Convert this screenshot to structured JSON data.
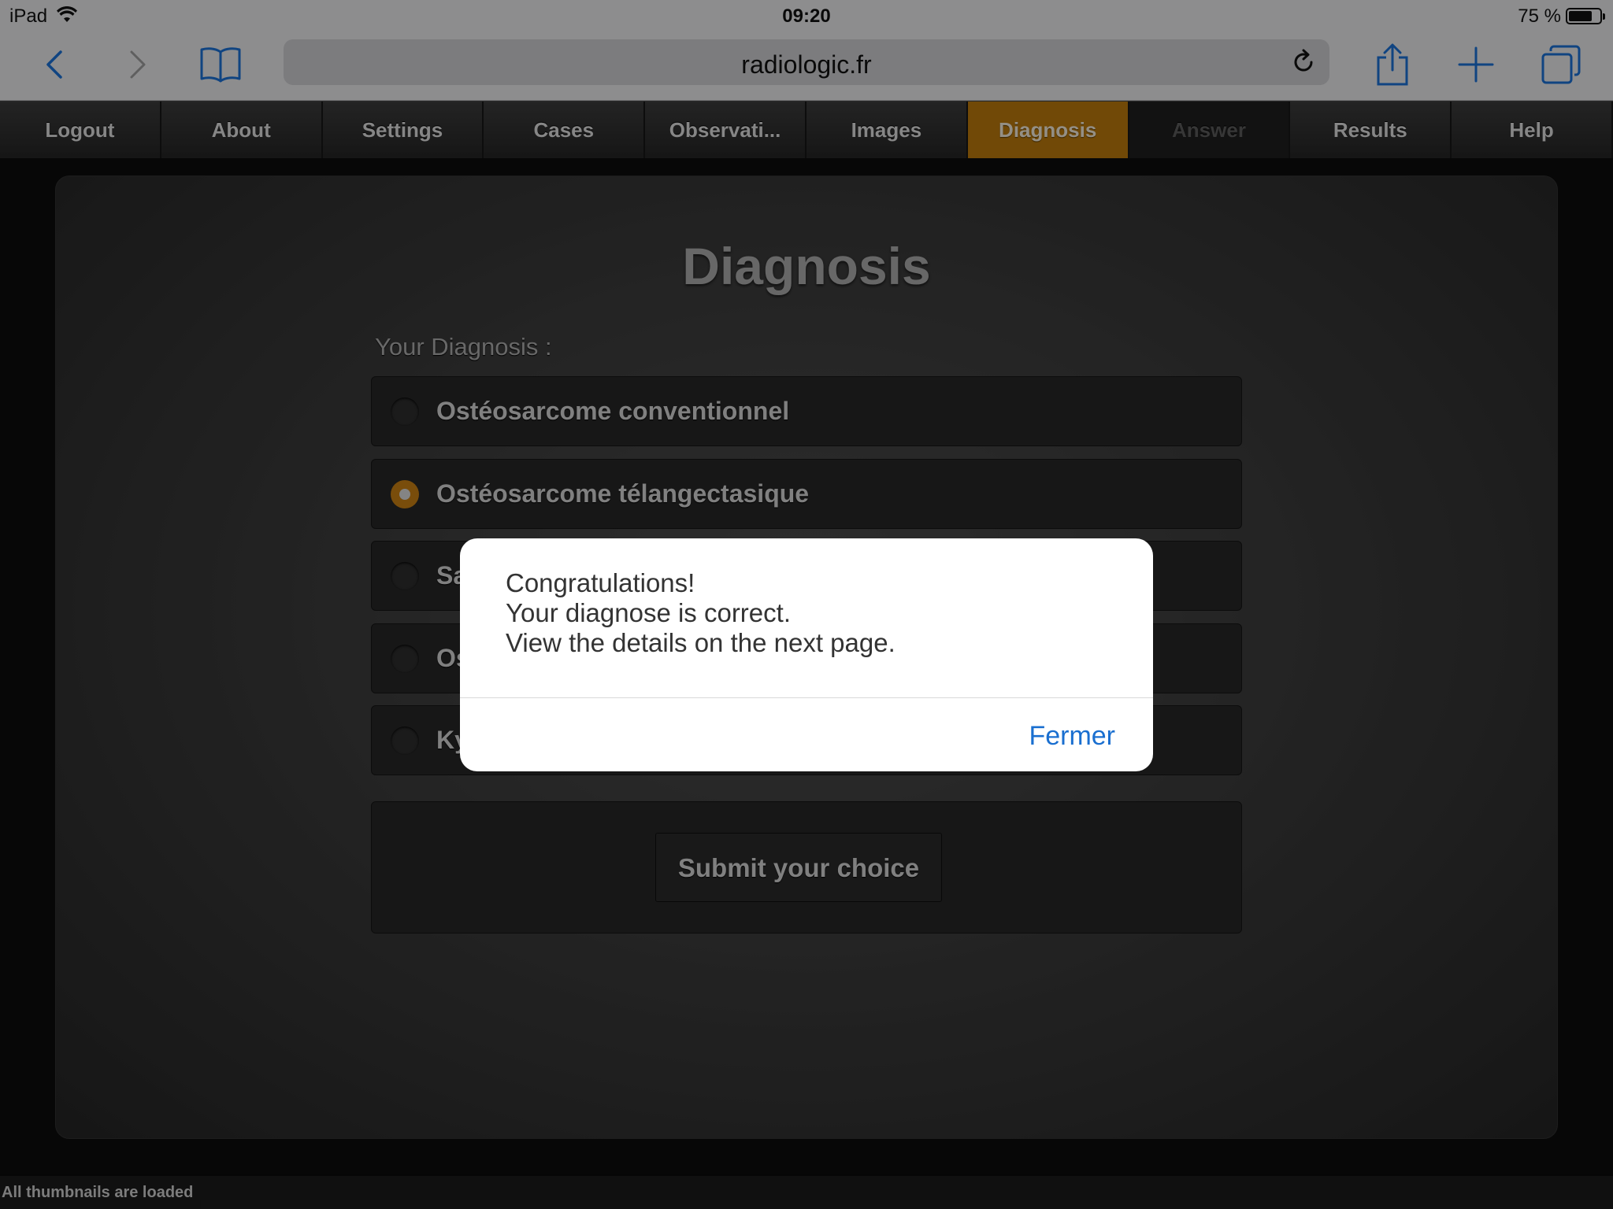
{
  "status_bar": {
    "device": "iPad",
    "time": "09:20",
    "battery": "75 %",
    "battery_level": 0.75,
    "wifi_icon": "wifi-icon"
  },
  "browser": {
    "url": "radiologic.fr",
    "icons": [
      "back-icon",
      "forward-icon",
      "bookmarks-icon",
      "reload-icon",
      "share-icon",
      "new-tab-icon",
      "tabs-icon"
    ]
  },
  "nav": {
    "tabs": [
      {
        "label": "Logout",
        "state": "normal"
      },
      {
        "label": "About",
        "state": "normal"
      },
      {
        "label": "Settings",
        "state": "normal"
      },
      {
        "label": "Cases",
        "state": "normal"
      },
      {
        "label": "Observati...",
        "state": "normal"
      },
      {
        "label": "Images",
        "state": "normal"
      },
      {
        "label": "Diagnosis",
        "state": "active"
      },
      {
        "label": "Answer",
        "state": "disabled"
      },
      {
        "label": "Results",
        "state": "normal"
      },
      {
        "label": "Help",
        "state": "normal"
      }
    ],
    "accent_color": "#b7770c"
  },
  "main": {
    "title": "Diagnosis",
    "prompt": "Your Diagnosis :",
    "options": [
      {
        "label": "Ostéosarcome conventionnel",
        "checked": false
      },
      {
        "label": "Ostéosarcome télangectasique",
        "checked": true
      },
      {
        "label": "Sa",
        "checked": false
      },
      {
        "label": "Os",
        "checked": false
      },
      {
        "label": "Ky",
        "checked": false
      }
    ],
    "submit_label": "Submit your choice"
  },
  "alert": {
    "line1": "Congratulations!",
    "line2": "Your diagnose is correct.",
    "line3": "View the details on the next page.",
    "close_label": "Fermer",
    "link_color": "#1a6fd0"
  },
  "footer": {
    "status": "All thumbnails are loaded"
  }
}
